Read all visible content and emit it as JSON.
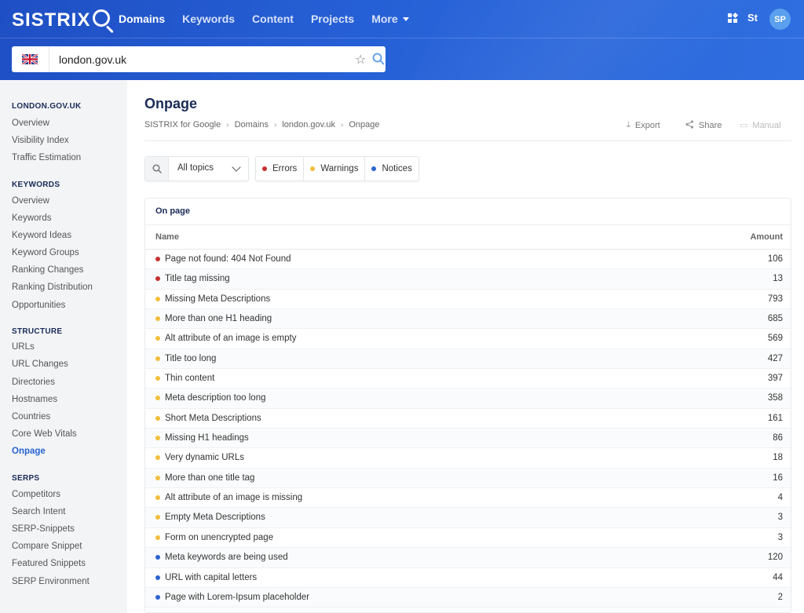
{
  "colors": {
    "error": "#c62f2f",
    "warning": "#f2be3a",
    "notice": "#2b63d0",
    "accent": "#2763d3",
    "header": "#2660d6"
  },
  "header": {
    "logo": "SISTRIX",
    "nav": [
      {
        "label": "Domains",
        "active": true
      },
      {
        "label": "Keywords"
      },
      {
        "label": "Content"
      },
      {
        "label": "Projects"
      },
      {
        "label": "More"
      }
    ],
    "user_short": "St",
    "avatar": "SP"
  },
  "search": {
    "value": "london.gov.uk",
    "flag": "uk-flag-icon"
  },
  "sidebar": {
    "sections": [
      {
        "title": "LONDON.GOV.UK",
        "items": [
          "Overview",
          "Visibility Index",
          "Traffic Estimation"
        ]
      },
      {
        "title": "KEYWORDS",
        "items": [
          "Overview",
          "Keywords",
          "Keyword Ideas",
          "Keyword Groups",
          "Ranking Changes",
          "Ranking Distribution",
          "Opportunities"
        ]
      },
      {
        "title": "STRUCTURE",
        "items": [
          "URLs",
          "URL Changes",
          "Directories",
          "Hostnames",
          "Countries",
          "Core Web Vitals",
          "Onpage"
        ]
      },
      {
        "title": "SERPS",
        "items": [
          "Competitors",
          "Search Intent",
          "SERP-Snippets",
          "Compare Snippet",
          "Featured Snippets",
          "SERP Environment"
        ]
      }
    ],
    "active_item": "Onpage"
  },
  "main": {
    "title": "Onpage",
    "breadcrumb": [
      "SISTRIX for Google",
      "Domains",
      "london.gov.uk",
      "Onpage"
    ],
    "actions": {
      "export": "Export",
      "share": "Share",
      "manual": "Manual"
    },
    "filters": {
      "topics": "All topics",
      "levels": [
        {
          "label": "Errors",
          "level": "error"
        },
        {
          "label": "Warnings",
          "level": "warning"
        },
        {
          "label": "Notices",
          "level": "notice"
        }
      ]
    },
    "table": {
      "title": "On page",
      "col_name": "Name",
      "col_amount": "Amount",
      "rows": [
        {
          "name": "Page not found: 404 Not Found",
          "amount": "106",
          "level": "error"
        },
        {
          "name": "Title tag missing",
          "amount": "13",
          "level": "error"
        },
        {
          "name": "Missing Meta Descriptions",
          "amount": "793",
          "level": "warning"
        },
        {
          "name": "More than one H1 heading",
          "amount": "685",
          "level": "warning"
        },
        {
          "name": "Alt attribute of an image is empty",
          "amount": "569",
          "level": "warning"
        },
        {
          "name": "Title too long",
          "amount": "427",
          "level": "warning"
        },
        {
          "name": "Thin content",
          "amount": "397",
          "level": "warning"
        },
        {
          "name": "Meta description too long",
          "amount": "358",
          "level": "warning"
        },
        {
          "name": "Short Meta Descriptions",
          "amount": "161",
          "level": "warning"
        },
        {
          "name": "Missing H1 headings",
          "amount": "86",
          "level": "warning"
        },
        {
          "name": "Very dynamic URLs",
          "amount": "18",
          "level": "warning"
        },
        {
          "name": "More than one title tag",
          "amount": "16",
          "level": "warning"
        },
        {
          "name": "Alt attribute of an image is missing",
          "amount": "4",
          "level": "warning"
        },
        {
          "name": "Empty Meta Descriptions",
          "amount": "3",
          "level": "warning"
        },
        {
          "name": "Form on unencrypted page",
          "amount": "3",
          "level": "warning"
        },
        {
          "name": "Meta keywords are being used",
          "amount": "120",
          "level": "notice"
        },
        {
          "name": "URL with capital letters",
          "amount": "44",
          "level": "notice"
        },
        {
          "name": "Page with Lorem-Ipsum placeholder",
          "amount": "2",
          "level": "notice"
        }
      ]
    }
  }
}
